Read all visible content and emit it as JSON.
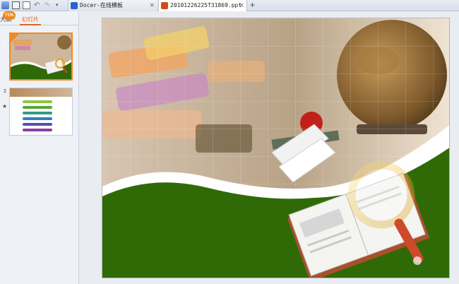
{
  "tabs": [
    {
      "label": "Docer-在线模板",
      "icon": "docer-logo-icon"
    },
    {
      "label": "20101226225T31869.ppt",
      "icon": "ppt-file-icon"
    }
  ],
  "new_tab_symbol": "+",
  "close_symbol": "×",
  "left_pane": {
    "zoom_badge": "71%",
    "tab_outline": "大纲",
    "tab_slides": "幻灯片",
    "slides": [
      {
        "number": "1",
        "selected": true
      },
      {
        "number": "2",
        "selected": false
      }
    ],
    "thumb2_items": [
      "Featured text",
      "Featured text",
      "Featured text",
      "Featured text",
      "Featured text",
      "Featured text"
    ]
  },
  "colors": {
    "accent": "#f08a1c",
    "slide_green": "#2f6a07",
    "tab_active": "#ffffff"
  },
  "icons": [
    "save-icon",
    "print-icon",
    "preview-icon",
    "undo-icon",
    "redo-icon",
    "dropdown-icon",
    "star-icon"
  ]
}
